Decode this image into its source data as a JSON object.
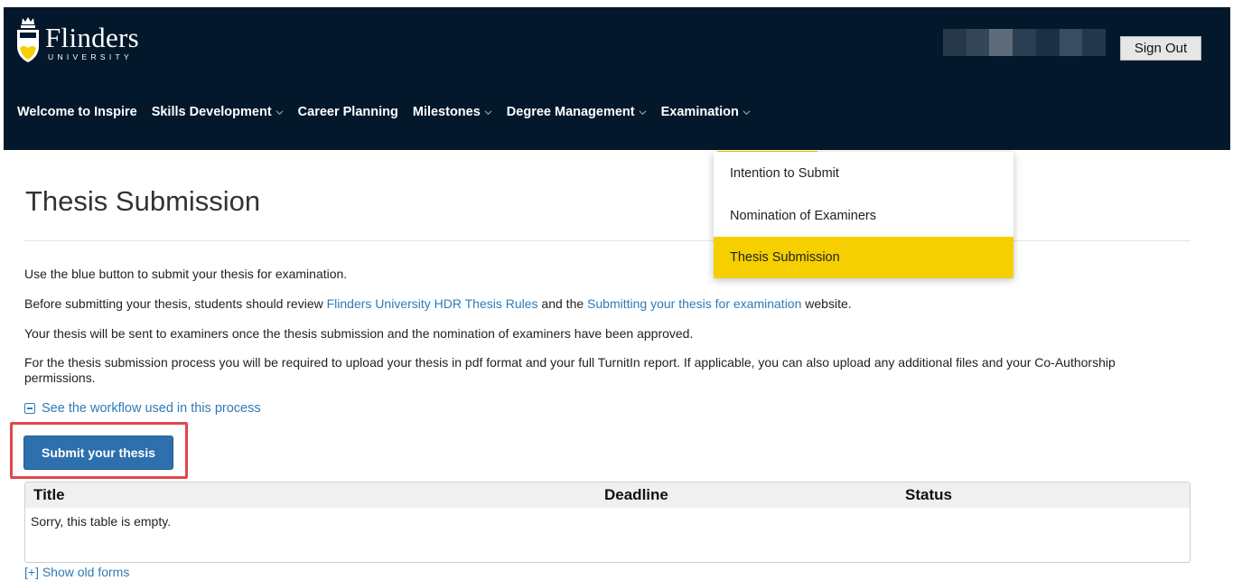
{
  "header": {
    "logo_name": "Flinders",
    "logo_sub": "UNIVERSITY",
    "sign_out": "Sign Out"
  },
  "nav": {
    "items": [
      {
        "label": "Welcome to Inspire",
        "has_menu": false
      },
      {
        "label": "Skills Development",
        "has_menu": true
      },
      {
        "label": "Career Planning",
        "has_menu": false
      },
      {
        "label": "Milestones",
        "has_menu": true
      },
      {
        "label": "Degree Management",
        "has_menu": true
      },
      {
        "label": "Examination",
        "has_menu": true
      }
    ],
    "active_item": "Examination"
  },
  "dropdown": {
    "items": [
      "Intention to Submit",
      "Nomination of Examiners",
      "Thesis Submission"
    ],
    "selected": "Thesis Submission"
  },
  "main": {
    "title": "Thesis Submission",
    "p1": "Use the blue button to submit your thesis for examination.",
    "p2_before": "Before submitting your thesis, students should review ",
    "p2_link1": "Flinders University HDR Thesis Rules",
    "p2_mid": " and the ",
    "p2_link2": "Submitting your thesis for examination",
    "p2_after": " website.",
    "p3": "Your thesis will be sent to examiners once the thesis submission and the nomination of examiners have been approved.",
    "p4": "For the thesis submission process you will be required to upload your thesis in pdf format and your full TurnitIn report. If applicable, you can also upload any additional files and your Co-Authorship permissions.",
    "workflow_link": "See the workflow used in this process",
    "submit_button": "Submit your thesis",
    "table": {
      "columns": [
        "Title",
        "Deadline",
        "Status"
      ],
      "empty_message": "Sorry, this table is empty."
    },
    "show_old": "[+] Show old forms"
  },
  "colors": {
    "header_bg": "#03182b",
    "accent_yellow": "#f5cf00",
    "link_blue": "#2e7bb8",
    "button_blue": "#2e6fae",
    "highlight_red": "#e0474c"
  },
  "icons": {
    "logo": "university-crest-icon",
    "nav_menu": "chevron-down-icon",
    "workflow": "collapse-minus-icon"
  }
}
